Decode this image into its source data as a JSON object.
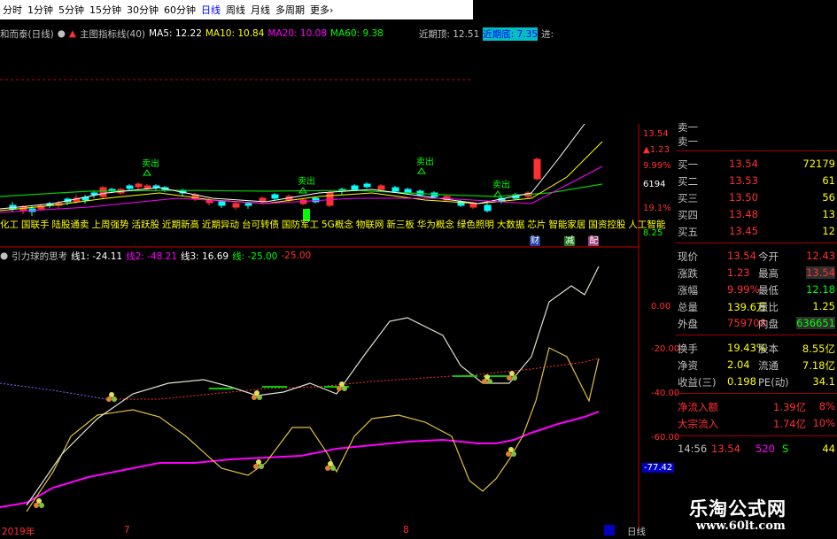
{
  "topbar": {
    "tabs": [
      "分时",
      "1分钟",
      "5分钟",
      "15分钟",
      "30分钟",
      "60分钟",
      "日线",
      "周线",
      "月线",
      "多周期",
      "更多›"
    ],
    "active_index": 6
  },
  "main_info": {
    "stock": "和而泰(日线)",
    "arrow": "▲",
    "main_indicator": "主图指标线(40)",
    "ma5": "MA5: 12.22",
    "ma10": "MA10: 10.84",
    "ma20": "MA20: 10.08",
    "ma60": "MA60: 9.38",
    "recent": "近期顶: 12.51",
    "recent2": "近期底: 7.35",
    "extra": "进:"
  },
  "main_axis": {
    "labels": [
      "13.54",
      "▲1.23",
      "9.99%",
      "6194",
      "19.1%",
      "8.25"
    ]
  },
  "main_marks": {
    "sell": "卖出"
  },
  "ticker": {
    "items": [
      "化工",
      "国联手",
      "陆股通卖",
      "上周强势",
      "活跃股",
      "近期新高",
      "近期异动",
      "台可转债",
      "国防军工",
      "5G概念",
      "物联网",
      "新三板",
      "华为概念",
      "绿色照明",
      "大数据",
      "芯片",
      "智能家居",
      "国资控股",
      "人工智能"
    ]
  },
  "ticker_badges": [
    "财",
    "减",
    "配"
  ],
  "indicator_info": {
    "name": "引力球的思考",
    "line1": "线1: -24.11",
    "line2": "线2: -48.21",
    "line3": "线3: 16.69",
    "line4": "线: -25.00",
    "line5": "-25.00"
  },
  "indicator_axis": {
    "labels": [
      "0.00",
      "-20.00",
      "-40.00",
      "-60.00",
      "-77.42"
    ]
  },
  "bottom_axis": {
    "labels": [
      "2019年",
      "7",
      "8"
    ],
    "right_label": "日线"
  },
  "quote": {
    "sell_rows": [
      {
        "label": "卖一"
      },
      {
        "label": "卖一"
      }
    ],
    "buy_rows": [
      {
        "label": "买一",
        "price": "13.54",
        "vol": "72179"
      },
      {
        "label": "买二",
        "price": "13.53",
        "vol": "61"
      },
      {
        "label": "买三",
        "price": "13.50",
        "vol": "56"
      },
      {
        "label": "买四",
        "price": "13.48",
        "vol": "13"
      },
      {
        "label": "买五",
        "price": "13.45",
        "vol": "12"
      }
    ],
    "stats1": [
      {
        "l1": "现价",
        "v1": "13.54",
        "l2": "今开",
        "v2": "12.43"
      },
      {
        "l1": "涨跌",
        "v1": "1.23",
        "l2": "最高",
        "v2": "13.54"
      },
      {
        "l1": "涨幅",
        "v1": "9.99%",
        "l2": "最低",
        "v2": "12.18"
      },
      {
        "l1": "总量",
        "v1": "139.6万",
        "l2": "量比",
        "v2": "1.25"
      },
      {
        "l1": "外盘",
        "v1": "759708",
        "l2": "内盘",
        "v2": "636651"
      }
    ],
    "stats2": [
      {
        "l1": "换手",
        "v1": "19.43%",
        "l2": "股本",
        "v2": "8.55亿"
      },
      {
        "l1": "净资",
        "v1": "2.04",
        "l2": "流通",
        "v2": "7.18亿"
      },
      {
        "l1": "收益(三)",
        "v1": "0.198",
        "l2": "PE(动)",
        "v2": "34.1"
      }
    ],
    "flows": [
      {
        "label": "净流入额",
        "v1": "1.39亿",
        "v2": "8%"
      },
      {
        "label": "大宗流入",
        "v1": "1.74亿",
        "v2": "10%"
      }
    ],
    "tick": {
      "time": "14:56",
      "price": "13.54",
      "vol": "520",
      "dir": "S",
      "num": "44"
    }
  },
  "watermark": {
    "title": "乐淘公式网",
    "url": "www.60lt.com"
  },
  "colors": {
    "red": "#ff3030",
    "green": "#00ff00",
    "yellow": "#ffff00",
    "white": "#ffffff",
    "magenta": "#ff00ff",
    "cyan": "#00ffff",
    "gray": "#c0c0c0"
  }
}
